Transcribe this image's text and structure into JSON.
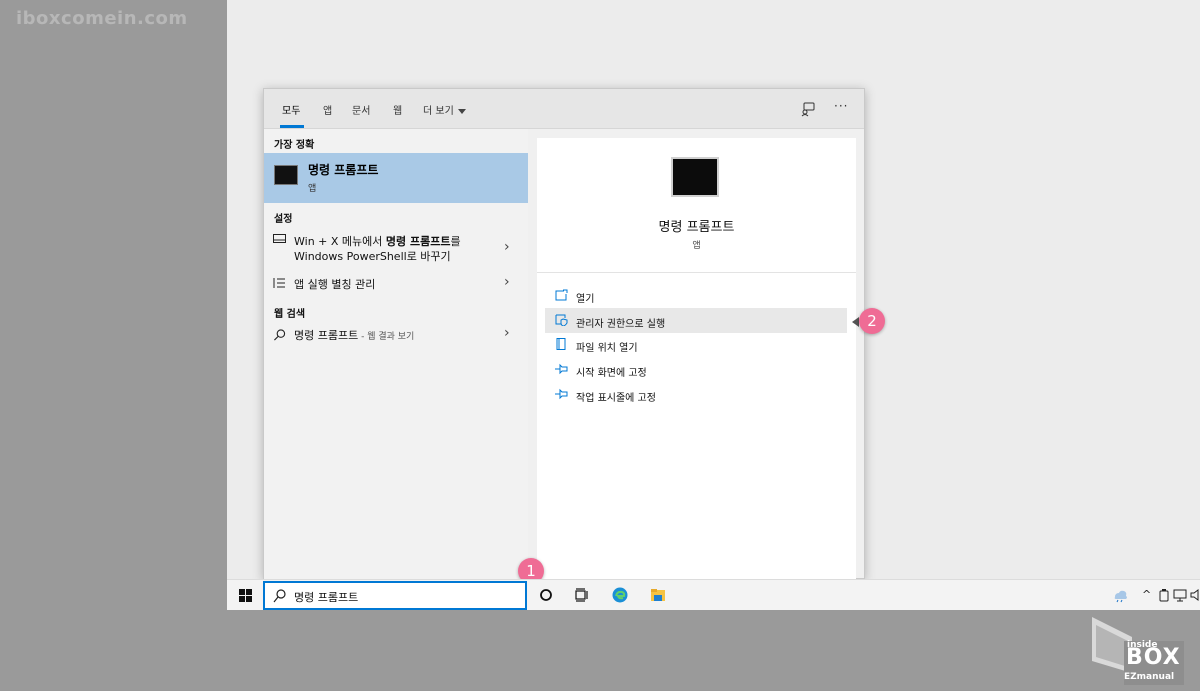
{
  "watermark": "iboxcomein.com",
  "tabs": {
    "all": "모두",
    "apps": "앱",
    "documents": "문서",
    "web": "웹",
    "more": "더 보기"
  },
  "left": {
    "best_match_header": "가장 정확",
    "best_match_title": "명령 프롬프트",
    "best_match_sub": "앱",
    "settings_header": "설정",
    "settings_item1_line1_prefix": "Win + X 메뉴에서 ",
    "settings_item1_line1_bold": "명령 프롬프트",
    "settings_item1_line1_suffix": "를",
    "settings_item1_line2": "Windows PowerShell로 바꾸기",
    "settings_item2": "앱 실행 별칭 관리",
    "web_header": "웹 검색",
    "web_item_title": "명령 프롬프트",
    "web_item_sub": " - 웹 결과 보기"
  },
  "preview": {
    "title": "명령 프롬프트",
    "subtitle": "앱",
    "actions": [
      "열기",
      "관리자 권한으로 실행",
      "파일 위치 열기",
      "시작 화면에 고정",
      "작업 표시줄에 고정"
    ]
  },
  "taskbar": {
    "search_value": "명령 프롬프트"
  },
  "badges": {
    "step1": "1",
    "step2": "2"
  },
  "logo": {
    "inside": "inside",
    "box": "BOX",
    "ez": "EZmanual"
  },
  "colors": {
    "accent": "#0078d4",
    "selected": "#a9c9e6",
    "badge": "#ef6c95"
  }
}
